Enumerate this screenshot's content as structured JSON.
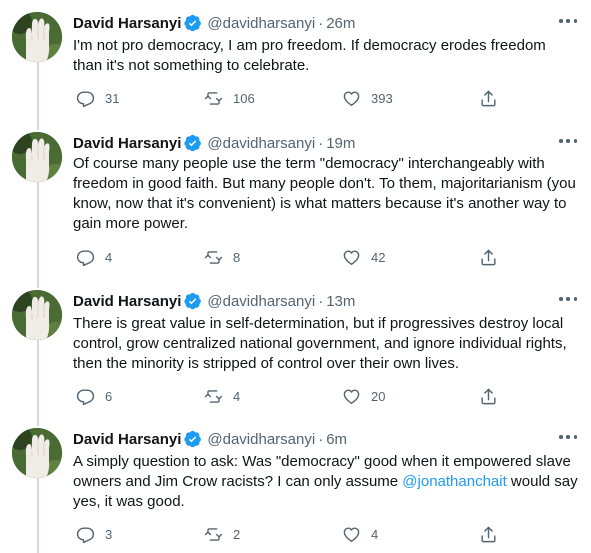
{
  "author": {
    "name": "David Harsanyi",
    "handle": "@davidharsanyi",
    "dot": "·"
  },
  "tweets": [
    {
      "time": "26m",
      "text": "I'm not pro democracy, I am pro freedom. If democracy erodes freedom than it's not something to celebrate.",
      "replies": "31",
      "retweets": "106",
      "likes": "393"
    },
    {
      "time": "19m",
      "text": "Of course many people use the term \"democracy\" interchangeably with freedom in good faith. But many people don't. To them, majoritarianism (you know, now that it's convenient) is what matters because it's another way to gain more power.",
      "replies": "4",
      "retweets": "8",
      "likes": "42"
    },
    {
      "time": "13m",
      "text": "There is great value in self-determination, but if progressives destroy local control, grow centralized national government, and ignore individual rights, then the minority is stripped of control over their own lives.",
      "replies": "6",
      "retweets": "4",
      "likes": "20"
    },
    {
      "time": "6m",
      "text_before": "A simply question to ask: Was \"democracy\" good when it empowered slave owners and Jim Crow racists? I can only assume ",
      "mention": "@jonathanchait",
      "text_after": " would say yes, it was good.",
      "replies": "3",
      "retweets": "2",
      "likes": "4"
    }
  ],
  "colors": {
    "accent": "#1d9bf0",
    "text": "#0f1419",
    "secondary": "#536471",
    "thread_line": "#cfd9de"
  }
}
